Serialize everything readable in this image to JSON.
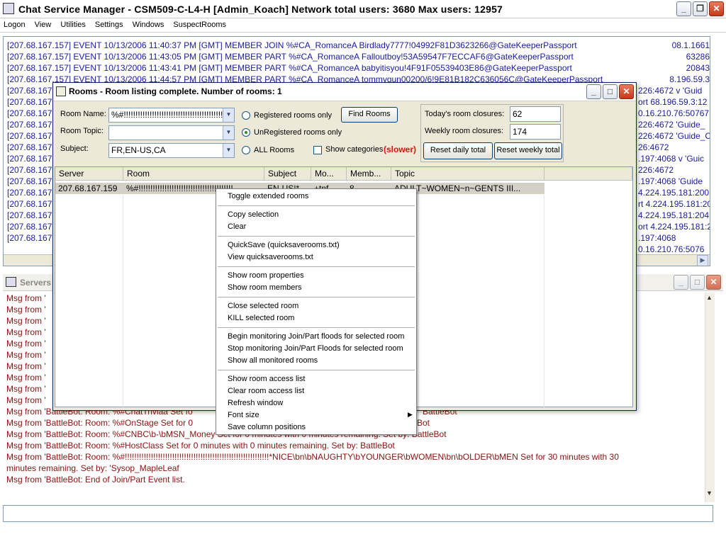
{
  "app": {
    "title": "Chat Service Manager - CSM509-C-L4-H  [Admin_Koach]    Network total users: 3680     Max users: 12957",
    "icon": "monitor-icon"
  },
  "menu": [
    "Logon",
    "View",
    "Utilities",
    "Settings",
    "Windows",
    "SuspectRooms"
  ],
  "log": {
    "lines": [
      "[207.68.167.157] EVENT 10/13/2006 11:40:37 PM [GMT]  MEMBER JOIN %#CA_RomanceA Birdlady7777!04992F81D3623266@GateKeeperPassport",
      "[207.68.167.157] EVENT 10/13/2006 11:43:05 PM [GMT]  MEMBER PART %#CA_RomanceA Falloutboy!53A59547F7ECCAF6@GateKeeperPassport",
      "[207.68.167.157] EVENT 10/13/2006 11:43:41 PM [GMT]  MEMBER PART %#CA_RomanceA babyitisyou!4F91F05539403E86@GateKeeperPassport",
      "[207.68.167.157] EVENT 10/13/2006 11:44:57 PM [GMT]  MEMBER PART %#CA_RomanceA tommygun00200/6!9E81B182C636056C@GateKeeperPassport"
    ],
    "left_stubs": [
      "[207.68.167",
      "[207.68.167",
      "[207.68.167",
      "[207.68.167",
      "[207.68.167",
      "[207.68.167",
      "[207.68.167",
      "[207.68.167",
      "[207.68.167",
      "[207.68.167",
      "[207.68.167",
      "[207.68.167",
      "[207.68.167",
      "[207.68.167"
    ],
    "right_stubs": [
      "226:4672 v 'Guid",
      "ort 68.196.59.3:12",
      "0.16.210.76:50767",
      "226:4672  'Guide_",
      "226:4672 'Guide_C",
      "26:4672",
      ".197:4068 v 'Guic",
      "226:4672",
      ".197:4068  'Guide",
      "4.224.195.181:200",
      "rt 4.224.195.181:20",
      "4.224.195.181:204",
      "ort 4.224.195.181:20",
      ".197:4068",
      "0.16.210.76:5076"
    ],
    "top_right": [
      "08.1.1661",
      "63286",
      "20843",
      "8.196.59.3"
    ]
  },
  "servers_panel": {
    "title": "Servers",
    "messages_short": [
      "Msg from '",
      "Msg from '",
      "Msg from '",
      "Msg from '",
      "Msg from '",
      "Msg from '",
      "Msg from '",
      "Msg from '",
      "Msg from '",
      "Msg from '"
    ],
    "messages_partial": [
      {
        "left": "Msg from 'BattleBot: Room: %#ChatTriviaa  Set fo",
        "right": "BattleBot"
      },
      {
        "left": "Msg from 'BattleBot: Room: %#OnStage  Set for 0",
        "right": "Bot"
      },
      {
        "left": "Msg from 'BattleBot: Room: %#CNBC\\b-\\bMSN_Money  Set for 0 minutes with 0 minutes remaining.   Set by: BattleBot",
        "right": ""
      },
      {
        "left": "Msg from 'BattleBot: Room: %#HostClass  Set for 0 minutes with 0 minutes remaining.   Set by: BattleBot",
        "right": ""
      },
      {
        "left": "Msg from 'BattleBot: Room: %#!!!!!!!!!!!!!!!!!!!!!!!!!!!!!!!!!!!!!!!!!!!!!!!!!!!!!!!!!!!!!*NICE\\bn\\bNAUGHTY\\bYOUNGER\\bWOMEN\\bn\\bOLDER\\bMEN  Set for 30 minutes with 30",
        "right": ""
      },
      {
        "left": "minutes remaining.   Set by: 'Sysop_MapleLeaf",
        "right": ""
      },
      {
        "left": "Msg from 'BattleBot: End of Join/Part Event list.",
        "right": ""
      }
    ]
  },
  "dialog": {
    "title": "Rooms - Room listing complete. Number of rooms: 1",
    "room_name_label": "Room Name:",
    "room_name_value": "%#!!!!!!!!!!!!!!!!!!!!!!!!!!!!!!!!!!!!!!!!!!!",
    "room_topic_label": "Room Topic:",
    "room_topic_value": "",
    "subject_label": "Subject:",
    "subject_value": "FR,EN-US,CA",
    "radio_registered": "Registered rooms only",
    "radio_unregistered": "UnRegistered rooms only",
    "radio_all": "ALL Rooms",
    "show_categories": "Show categories",
    "slower": "(slower)",
    "find_rooms": "Find Rooms",
    "todays_closures_label": "Today's room closures:",
    "todays_closures_value": "62",
    "weekly_closures_label": "Weekly room closures:",
    "weekly_closures_value": "174",
    "reset_daily": "Reset daily total",
    "reset_weekly": "Reset weekly total",
    "columns": [
      "Server",
      "Room",
      "Subject",
      "Mo...",
      "Memb...",
      "Topic"
    ],
    "row": [
      "207.68.167.159",
      "%#!!!!!!!!!!!!!!!!!!!!!!!!!!!!!!!!!!!!!!!!",
      "EN-US|*",
      "+tnf",
      "8",
      "ADULT~WOMEN~n~GENTS III..."
    ]
  },
  "context_menu": {
    "groups": [
      [
        "Toggle extended rooms"
      ],
      [
        "Copy selection",
        "Clear"
      ],
      [
        "QuickSave (quicksaverooms.txt)",
        "View quicksaverooms.txt"
      ],
      [
        "Show room properties",
        "Show room members"
      ],
      [
        "Close selected room",
        "KILL selected room"
      ],
      [
        "Begin monitoring Join/Part floods for selected room",
        "Stop monitoring Join/Part Floods for selected room",
        "Show all monitored rooms"
      ],
      [
        "Show room access list",
        "Clear room access list",
        "Refresh window",
        "Font size",
        "Save column positions"
      ]
    ]
  }
}
